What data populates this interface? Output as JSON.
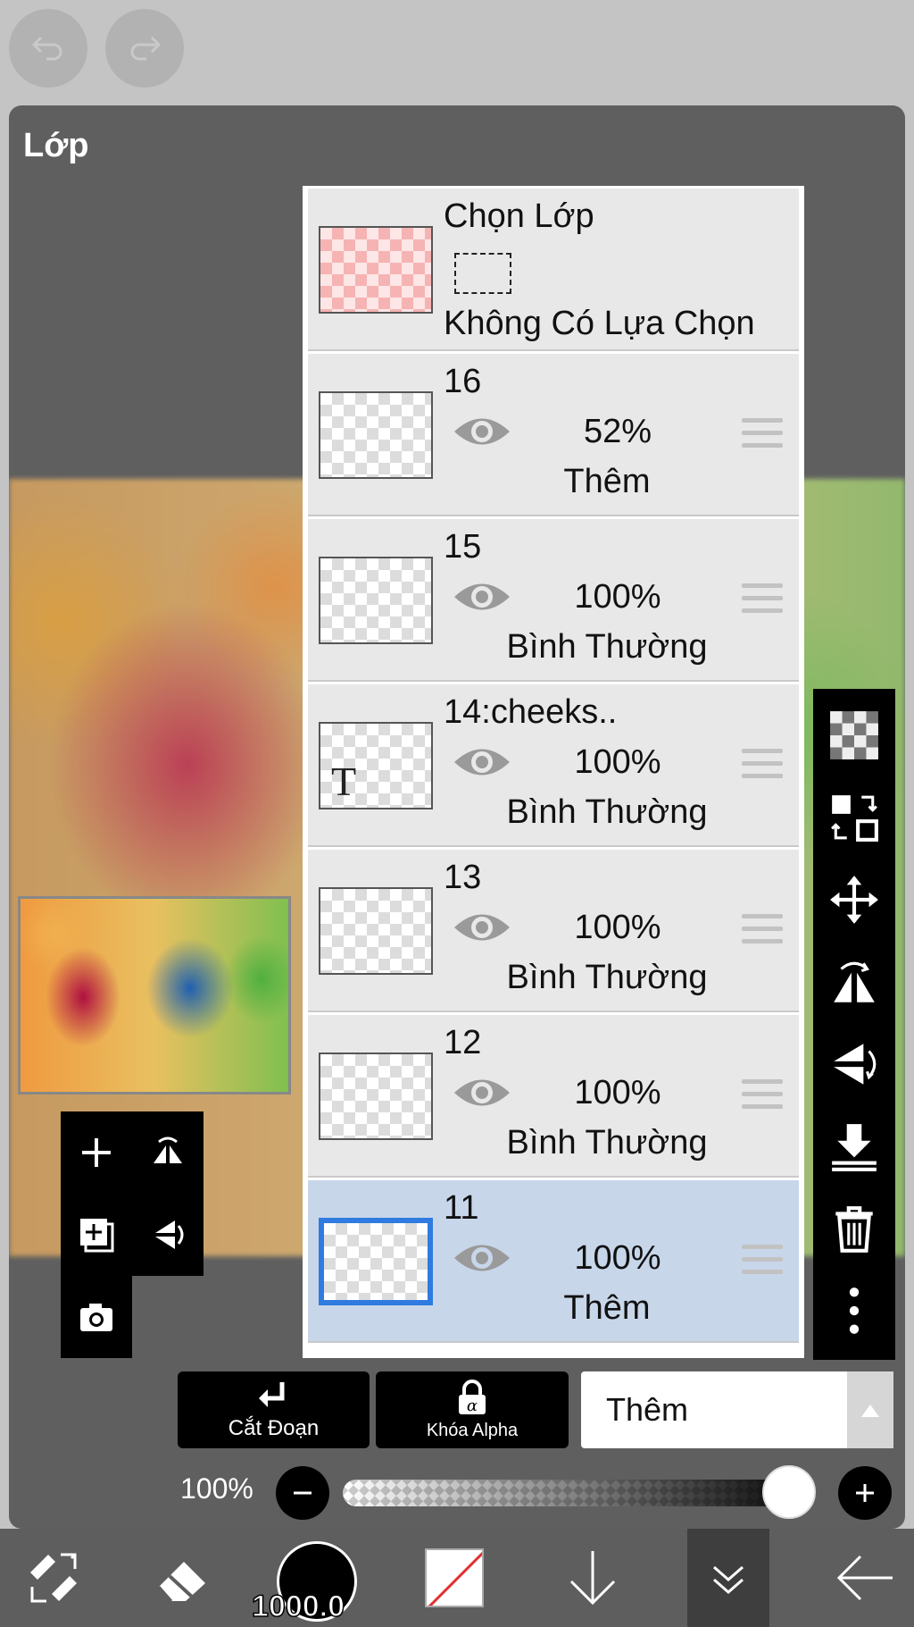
{
  "panel": {
    "title": "Lớp"
  },
  "selection_layer": {
    "title": "Chọn Lớp",
    "status": "Không Có Lựa Chọn"
  },
  "layers": [
    {
      "name": "16",
      "opacity": "52%",
      "blend": "Thêm"
    },
    {
      "name": "15",
      "opacity": "100%",
      "blend": "Bình Thường"
    },
    {
      "name": "14:cheeks..",
      "opacity": "100%",
      "blend": "Bình Thường"
    },
    {
      "name": "13",
      "opacity": "100%",
      "blend": "Bình Thường"
    },
    {
      "name": "12",
      "opacity": "100%",
      "blend": "Bình Thường"
    },
    {
      "name": "11",
      "opacity": "100%",
      "blend": "Thêm"
    }
  ],
  "selected_layer": "11",
  "actions": {
    "clipping": "Cắt Đoạn",
    "alpha_lock": "Khóa Alpha",
    "alpha_glyph": "α",
    "blend_mode": "Thêm"
  },
  "opacity": {
    "label": "100%",
    "value": 1.0
  },
  "toolbar": {
    "brush_size": "1000.0"
  },
  "colors": {
    "accent": "#2f7be0",
    "selected_row": "#c8d6ea",
    "panel": "#5f5f5f"
  }
}
